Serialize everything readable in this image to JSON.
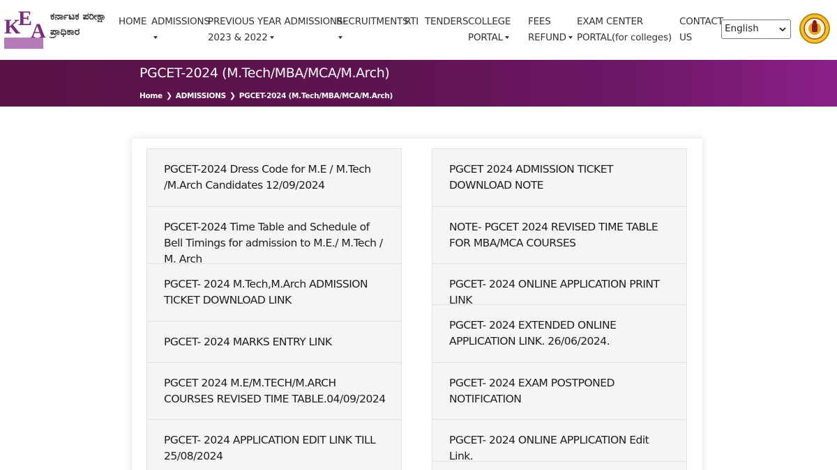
{
  "header": {
    "logo": {
      "letters": [
        "K",
        "E",
        "A"
      ],
      "kannada_line1": "ಕರ್ನಾಟಕ ಪರೀಕ್ಷಾ",
      "kannada_line2": "ಪ್ರಾಧಿಕಾರ"
    },
    "nav": [
      {
        "line1": "HOME",
        "line2": ""
      },
      {
        "line1": "ADMISSIONS",
        "line2": ""
      },
      {
        "line1": "PREVIOUS YEAR ADMISSIONS-",
        "line2": "2023 & 2022"
      },
      {
        "line1": "RECRUITMENTS",
        "line2": ""
      },
      {
        "line1": "RTI",
        "line2": ""
      },
      {
        "line1": "TENDERS",
        "line2": ""
      },
      {
        "line1": "COLLEGE",
        "line2": "PORTAL"
      },
      {
        "line1": "FEES",
        "line2": "REFUND"
      },
      {
        "line1": "EXAM CENTER",
        "line2": "PORTAL(for colleges)"
      },
      {
        "line1": "CONTACT",
        "line2": "US"
      }
    ],
    "language": {
      "selected": "English",
      "options": [
        "English"
      ]
    },
    "emblem_icon": "karnataka-government-emblem-icon"
  },
  "banner": {
    "title": "PGCET-2024 (M.Tech/MBA/MCA/M.Arch)",
    "breadcrumb": [
      "Home",
      "ADMISSIONS",
      "PGCET-2024 (M.Tech/MBA/MCA/M.Arch)"
    ]
  },
  "links": {
    "left": [
      "PGCET-2024 Dress Code for M.E / M.Tech /M.Arch Candidates 12/09/2024",
      "PGCET-2024 Time Table and Schedule of Bell Timings for admission to M.E./ M.Tech / M. Arch",
      "PGCET- 2024 M.Tech,M.Arch ADMISSION TICKET DOWNLOAD LINK",
      "PGCET- 2024 MARKS ENTRY LINK",
      "PGCET 2024 M.E/M.TECH/M.ARCH COURSES REVISED TIME TABLE.04/09/2024",
      "PGCET- 2024 APPLICATION EDIT LINK TILL 25/08/2024"
    ],
    "right": [
      "PGCET 2024 ADMISSION TICKET DOWNLOAD NOTE",
      "NOTE- PGCET 2024 REVISED TIME TABLE FOR MBA/MCA COURSES",
      "PGCET- 2024 ONLINE APPLICATION PRINT LINK",
      "PGCET- 2024 EXTENDED ONLINE APPLICATION LINK. 26/06/2024.",
      "PGCET- 2024 EXAM POSTPONED NOTIFICATION",
      "PGCET- 2024 ONLINE APPLICATION Edit Link.",
      ""
    ]
  },
  "colors": {
    "brand_purple": "#7a2c7e",
    "banner_dark": "#5a1346",
    "banner_light": "#8a2088",
    "item_bg": "#f5f5f5"
  }
}
